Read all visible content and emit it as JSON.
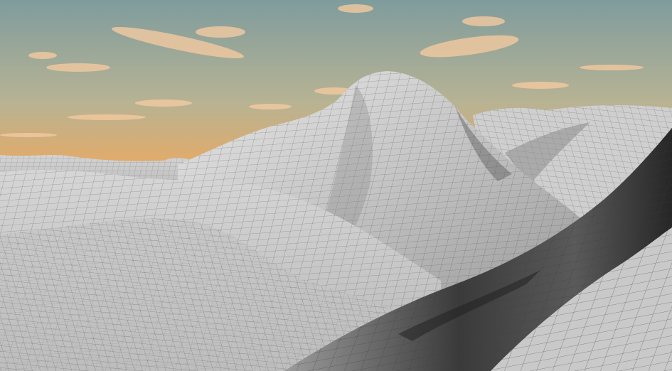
{
  "scene": {
    "kind": "3d-terrain-wireframe-render",
    "sky": {
      "top": "#7f9c9d",
      "mid": "#b7b394",
      "horizon": "#f2a85a",
      "cloud": "#f3c9a0"
    },
    "terrain": {
      "base": "#c9c9c9",
      "light": "#e2e2e2",
      "shadow": "#7a7a7a",
      "dark": "#2c2c2c",
      "mesh": "#4d4d4d"
    }
  }
}
